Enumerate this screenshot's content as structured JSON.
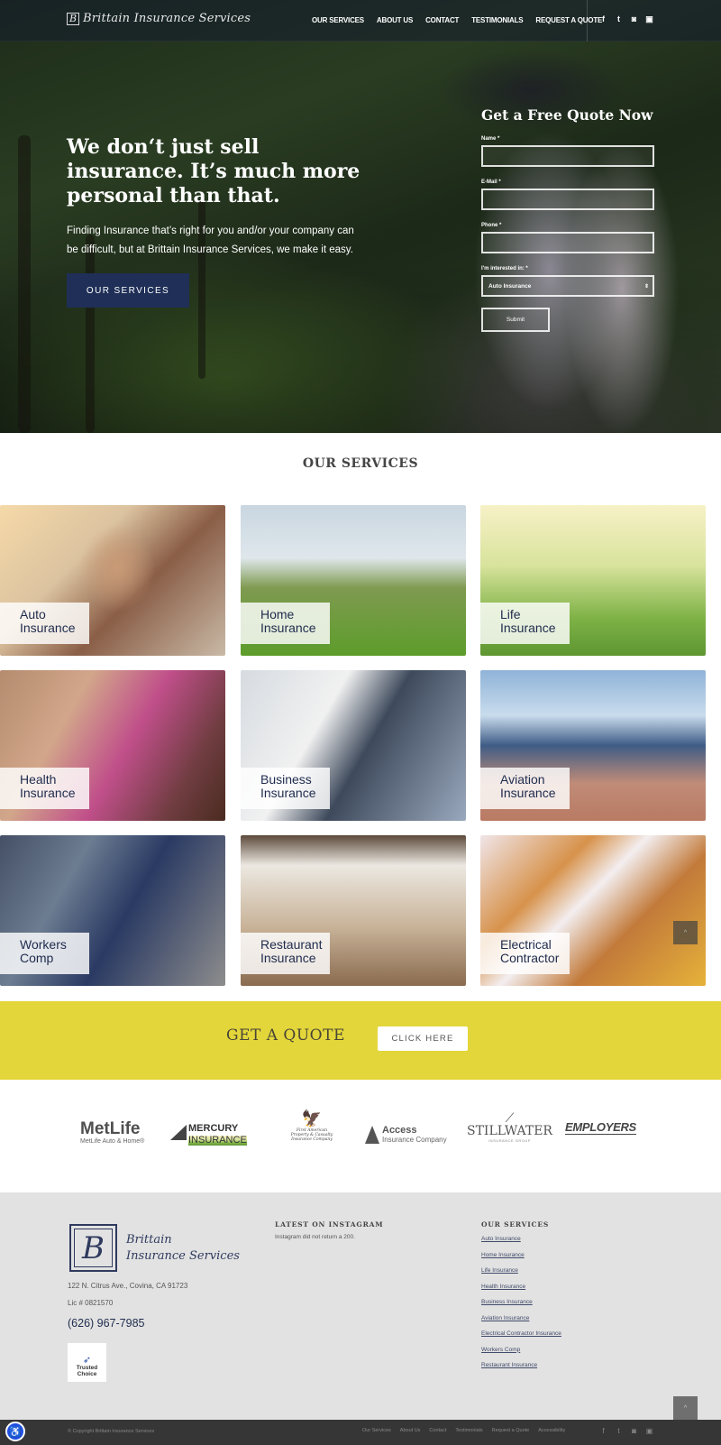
{
  "brand": {
    "name": "Brittain Insurance Services",
    "monogram": "B"
  },
  "nav": {
    "items": [
      "OUR SERVICES",
      "ABOUT US",
      "CONTACT",
      "TESTIMONIALS",
      "REQUEST A QUOTE"
    ],
    "social": [
      {
        "icon": "facebook-icon",
        "glyph": "f"
      },
      {
        "icon": "twitter-icon",
        "glyph": "🐦"
      },
      {
        "icon": "instagram-icon",
        "glyph": "◙"
      },
      {
        "icon": "youtube-icon",
        "glyph": "▣"
      }
    ]
  },
  "hero": {
    "heading": "We don‘t just sell insurance. It’s much more personal than that.",
    "subtext": "Finding Insurance that’s right for you and/or your company can be difficult, but at Brittain Insurance Services, we make it easy.",
    "button": "OUR SERVICES"
  },
  "quote_form": {
    "title": "Get a Free Quote Now",
    "fields": [
      {
        "label": "Name *",
        "value": ""
      },
      {
        "label": "E-Mail *",
        "value": ""
      },
      {
        "label": "Phone *",
        "value": ""
      }
    ],
    "interest_label": "I'm interested in: *",
    "interest_value": "Auto Insurance",
    "submit": "Submit"
  },
  "services": {
    "title": "OUR SERVICES",
    "tiles": [
      {
        "line1": "Auto",
        "line2": "Insurance"
      },
      {
        "line1": "Home",
        "line2": "Insurance"
      },
      {
        "line1": "Life",
        "line2": "Insurance"
      },
      {
        "line1": "Health",
        "line2": "Insurance"
      },
      {
        "line1": "Business",
        "line2": "Insurance"
      },
      {
        "line1": "Aviation",
        "line2": "Insurance"
      },
      {
        "line1": "Workers",
        "line2": "Comp"
      },
      {
        "line1": "Restaurant",
        "line2": "Insurance"
      },
      {
        "line1": "Electrical",
        "line2": "Contractor"
      }
    ]
  },
  "cta": {
    "title": "GET A QUOTE",
    "button": "CLICK HERE",
    "color": "#e3d63a"
  },
  "partners": {
    "metlife": {
      "name": "MetLife",
      "sub": "MetLife Auto & Home®"
    },
    "mercury": {
      "line1": "MERCURY",
      "line2": "INSURANCE"
    },
    "first_american": {
      "line1": "First American",
      "line2": "Property & Casualty",
      "line3": "Insurance Company"
    },
    "access": {
      "name": "Access",
      "sub": "Insurance Company"
    },
    "stillwater": {
      "name": "STILLWATER",
      "sub": "INSURANCE GROUP"
    },
    "employers": {
      "name": "EMPLOYERS"
    }
  },
  "footer": {
    "logo_line1": "Brittain",
    "logo_line2": "Insurance Services",
    "address": "122 N. Citrus Ave., Covina, CA 91723",
    "license": "Lic # 0821570",
    "phone": "(626) 967-7985",
    "trusted_choice": "Trusted Choice",
    "instagram_title": "LATEST ON INSTAGRAM",
    "instagram_message": "Instagram did not return a 200.",
    "services_title": "OUR SERVICES",
    "services_links": [
      "Auto Insurance",
      "Home Insurance",
      "Life Insurance",
      "Health Insurance",
      "Business Insurance",
      "Aviation Insurance",
      "Electrical Contractor Insurance",
      "Workers Comp",
      "Restaurant Insurance"
    ]
  },
  "bottom_bar": {
    "copyright": "© Copyright Brittain Insurance Services",
    "links": [
      "Our Services",
      "About Us",
      "Contact",
      "Testimonials",
      "Request a Quote",
      "Accessibility"
    ]
  },
  "scroll_top_glyph": "^",
  "accessibility_glyph": "☺"
}
